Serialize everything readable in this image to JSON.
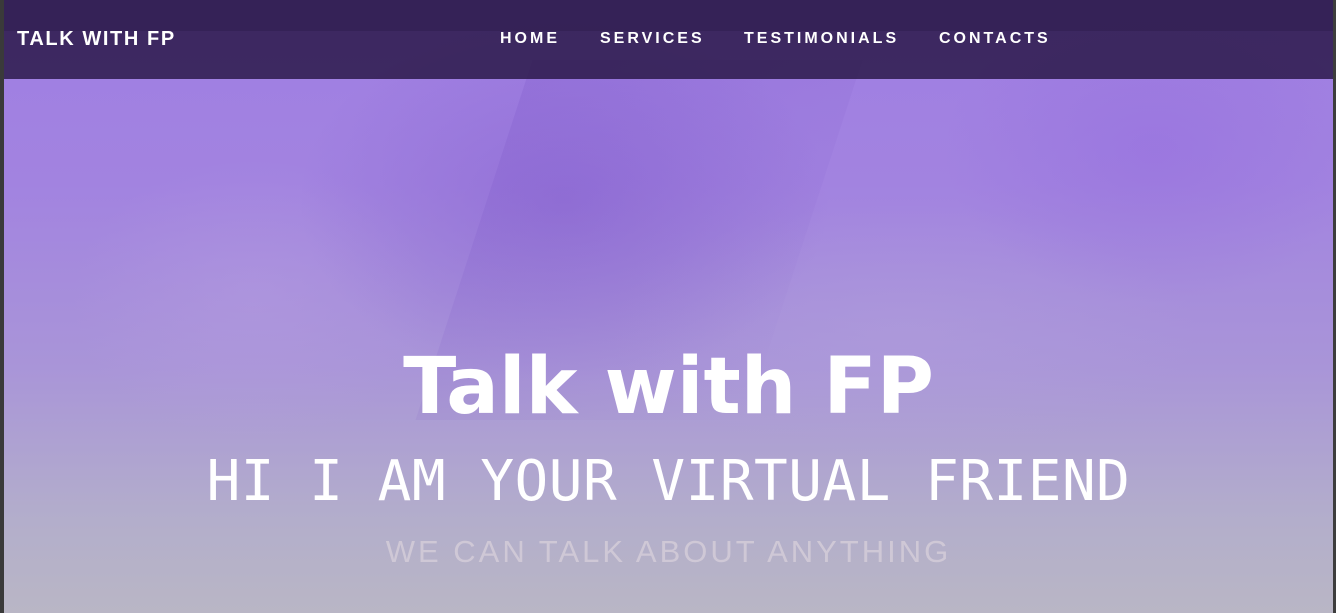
{
  "navbar": {
    "brand": "TALK WITH FP",
    "links": [
      {
        "label": "HOME"
      },
      {
        "label": "SERVICES"
      },
      {
        "label": "TESTIMONIALS"
      },
      {
        "label": "CONTACTS"
      }
    ]
  },
  "hero": {
    "title": "Talk with FP",
    "subtitle": "HI I AM YOUR VIRTUAL FRIEND",
    "tagline": "WE CAN TALK ABOUT ANYTHING"
  },
  "colors": {
    "navbar_bg": "#2a1848",
    "hero_purple": "#9f7ee3",
    "hero_bottom": "#b9b6c5",
    "text_primary": "#ffffff",
    "tagline_text": "#cfc8d6"
  }
}
